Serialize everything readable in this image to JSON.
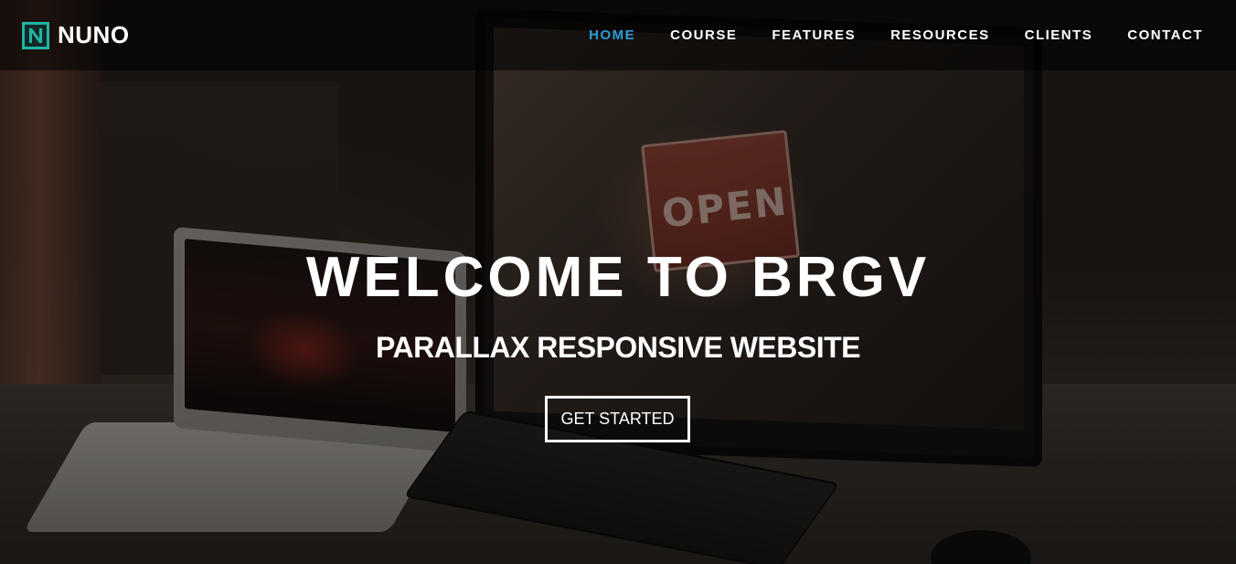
{
  "brand": {
    "name": "NUNO",
    "accent_color": "#23b3a4",
    "logo_icon": "n-square-logo-icon"
  },
  "nav": {
    "items": [
      {
        "label": "HOME",
        "active": true
      },
      {
        "label": "COURSE",
        "active": false
      },
      {
        "label": "FEATURES",
        "active": false
      },
      {
        "label": "RESOURCES",
        "active": false
      },
      {
        "label": "CLIENTS",
        "active": false
      },
      {
        "label": "CONTACT",
        "active": false
      }
    ],
    "active_color": "#2a9ed6"
  },
  "hero": {
    "title": "WELCOME TO BRGV",
    "subtitle": "PARALLAX RESPONSIVE WEBSITE",
    "cta_label": "GET STARTED",
    "background_sign_text": "OPEN"
  }
}
